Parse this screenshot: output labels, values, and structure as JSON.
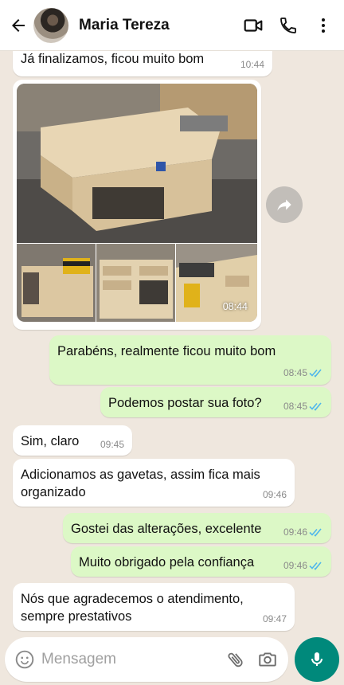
{
  "header": {
    "contact_name": "Maria Tereza",
    "icons": [
      "back-arrow-icon",
      "video-call-icon",
      "phone-icon",
      "more-vert-icon"
    ]
  },
  "messages": [
    {
      "direction": "in",
      "text": "Já finalizamos, ficou muito bom",
      "time": "10:44"
    },
    {
      "direction": "in",
      "type": "photo-album",
      "time": "08:44"
    },
    {
      "direction": "out",
      "text": "Parabéns, realmente ficou muito bom",
      "time": "08:45",
      "status": "read"
    },
    {
      "direction": "out",
      "text": "Podemos postar sua foto?",
      "time": "08:45",
      "status": "read"
    },
    {
      "direction": "in",
      "text": "Sim, claro",
      "time": "09:45"
    },
    {
      "direction": "in",
      "text": "Adicionamos as gavetas, assim fica mais organizado",
      "time": "09:46"
    },
    {
      "direction": "out",
      "text": "Gostei das alterações, excelente",
      "time": "09:46",
      "status": "read"
    },
    {
      "direction": "out",
      "text": "Muito obrigado pela confiança",
      "time": "09:46",
      "status": "read"
    },
    {
      "direction": "in",
      "text": "Nós que agradecemos o atendimento, sempre prestativos",
      "time": "09:47"
    }
  ],
  "composer": {
    "placeholder": "Mensagem",
    "icons": [
      "emoji-icon",
      "attach-icon",
      "camera-icon",
      "mic-icon"
    ]
  },
  "colors": {
    "chat_bg": "#efe7de",
    "incoming": "#ffffff",
    "outgoing": "#dcf8c6",
    "read_ticks": "#4fb6ec",
    "mic_button": "#00897b"
  }
}
